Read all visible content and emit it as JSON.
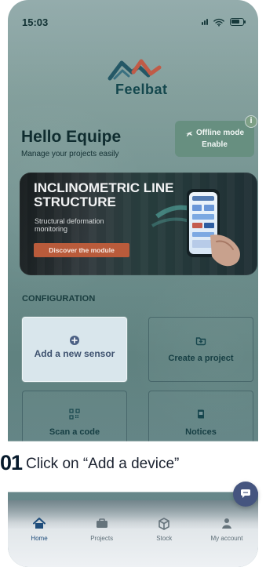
{
  "status_bar": {
    "time": "15:03"
  },
  "brand": {
    "name": "Feelbat"
  },
  "header": {
    "greeting": "Hello Equipe",
    "subtitle": "Manage your projects easily"
  },
  "offline": {
    "title": "Offline mode",
    "action": "Enable",
    "badge": "i"
  },
  "banner": {
    "title": "INCLINOMETRIC LINE STRUCTURE",
    "subtitle": "Structural deformation monitoring",
    "button": "Discover the module"
  },
  "configuration": {
    "title": "CONFIGURATION",
    "tiles": [
      {
        "label": "Add a new sensor"
      },
      {
        "label": "Create a project"
      },
      {
        "label": "Scan a code"
      },
      {
        "label": "Notices"
      }
    ]
  },
  "instruction": {
    "step": "01",
    "text": "Click on “Add a device”"
  },
  "bottom_nav": {
    "items": [
      {
        "label": "Home"
      },
      {
        "label": "Projects"
      },
      {
        "label": "Stock"
      },
      {
        "label": "My account"
      }
    ]
  },
  "colors": {
    "teal_bg": "#7f9c99",
    "accent_blue": "#1f4d7b",
    "offline_green": "#678f80",
    "banner_orange": "#b95b3b",
    "instruction_dark": "#071a2c"
  },
  "icons": {
    "signal": "signal-icon",
    "wifi": "wifi-icon",
    "battery": "battery-icon",
    "logo": "feelbat-logo",
    "plane": "airplane-icon",
    "info": "info-icon",
    "plus": "plus-circle-icon",
    "folder": "folder-plus-icon",
    "qr": "qr-code-icon",
    "book": "book-icon",
    "home": "home-icon",
    "projects": "briefcase-icon",
    "stock": "box-icon",
    "account": "user-icon",
    "chat": "chat-icon"
  }
}
